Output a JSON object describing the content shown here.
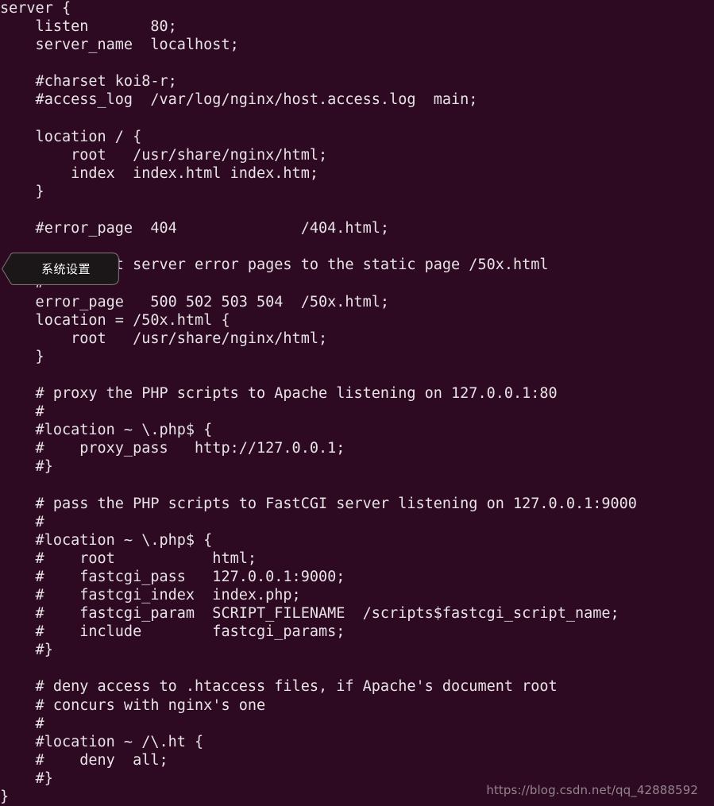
{
  "window": {
    "app": "terminal",
    "background_color": "#2d0a22",
    "foreground_color": "#e8e3e6"
  },
  "terminal": {
    "file_kind": "nginx-config",
    "lines": [
      "server {",
      "    listen       80;",
      "    server_name  localhost;",
      "",
      "    #charset koi8-r;",
      "    #access_log  /var/log/nginx/host.access.log  main;",
      "",
      "    location / {",
      "        root   /usr/share/nginx/html;",
      "        index  index.html index.htm;",
      "    }",
      "",
      "    #error_page  404              /404.html;",
      "",
      "    # redirect server error pages to the static page /50x.html",
      "    #",
      "    error_page   500 502 503 504  /50x.html;",
      "    location = /50x.html {",
      "        root   /usr/share/nginx/html;",
      "    }",
      "",
      "    # proxy the PHP scripts to Apache listening on 127.0.0.1:80",
      "    #",
      "    #location ~ \\.php$ {",
      "    #    proxy_pass   http://127.0.0.1;",
      "    #}",
      "",
      "    # pass the PHP scripts to FastCGI server listening on 127.0.0.1:9000",
      "    #",
      "    #location ~ \\.php$ {",
      "    #    root           html;",
      "    #    fastcgi_pass   127.0.0.1:9000;",
      "    #    fastcgi_index  index.php;",
      "    #    fastcgi_param  SCRIPT_FILENAME  /scripts$fastcgi_script_name;",
      "    #    include        fastcgi_params;",
      "    #}",
      "",
      "    # deny access to .htaccess files, if Apache's document root",
      "    # concurs with nginx's one",
      "    #",
      "    #location ~ /\\.ht {",
      "    #    deny  all;",
      "    #}",
      "}"
    ]
  },
  "tooltip": {
    "label": "系统设置",
    "background_color": "#1b1718",
    "text_color": "#ffffff",
    "border_color": "#6f6068"
  },
  "watermark": {
    "text": "https://blog.csdn.net/qq_42888592",
    "color": "#9c8f97"
  }
}
